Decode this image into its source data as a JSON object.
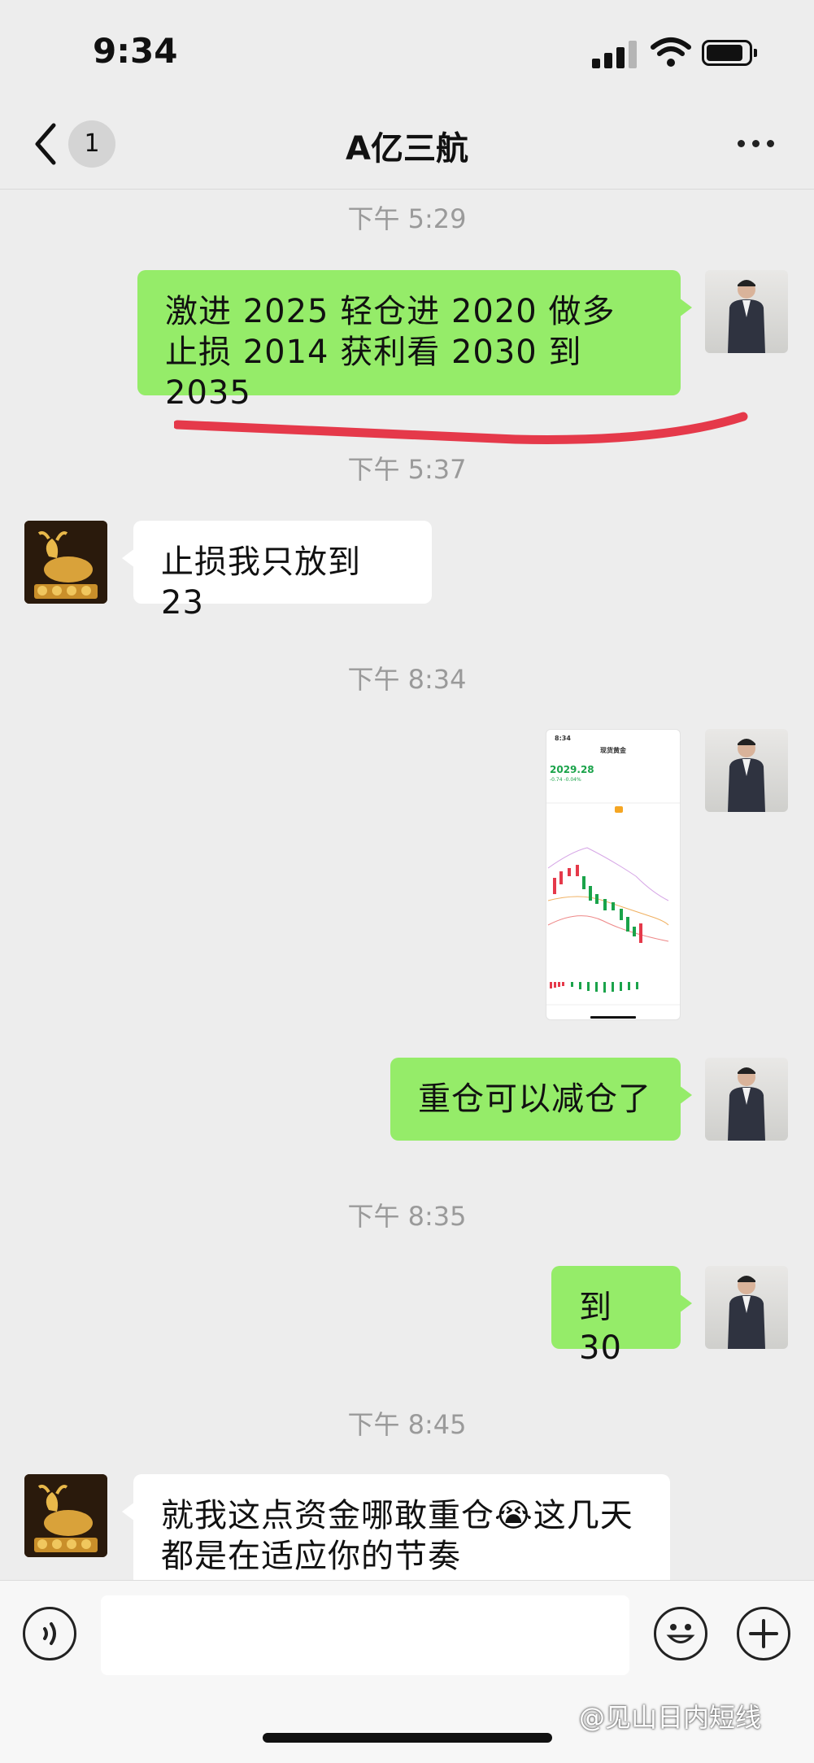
{
  "status_bar": {
    "time": "9:34"
  },
  "header": {
    "unread_count": "1",
    "title": "A亿三航"
  },
  "messages": [
    {
      "type": "timestamp",
      "text": "下午 5:29"
    },
    {
      "type": "text",
      "from": "me",
      "text": "激进 2025 轻仓进 2020 做多 止损 2014 获利看 2030 到 2035"
    },
    {
      "type": "timestamp",
      "text": "下午 5:37"
    },
    {
      "type": "text",
      "from": "other",
      "text": "止损我只放到 23"
    },
    {
      "type": "timestamp",
      "text": "下午 8:34"
    },
    {
      "type": "image",
      "from": "me",
      "time": "8:34",
      "title": "现货黄金",
      "price": "2029.28",
      "change": "-0.74 -0.04%"
    },
    {
      "type": "text",
      "from": "me",
      "text": "重仓可以减仓了"
    },
    {
      "type": "timestamp",
      "text": "下午 8:35"
    },
    {
      "type": "text",
      "from": "me",
      "text": "到 30"
    },
    {
      "type": "timestamp",
      "text": "下午 8:45"
    },
    {
      "type": "text",
      "from": "other",
      "text_line1": "就我这点资金哪敢重仓",
      "emoji": "😭",
      "text_line2": "这几天",
      "text_line3": "都是在适应你的节奏"
    }
  ],
  "watermark": "@见山日内短线",
  "colors": {
    "my_bubble": "#95ec69",
    "other_bubble": "#ffffff",
    "annotation": "#e5394a"
  }
}
